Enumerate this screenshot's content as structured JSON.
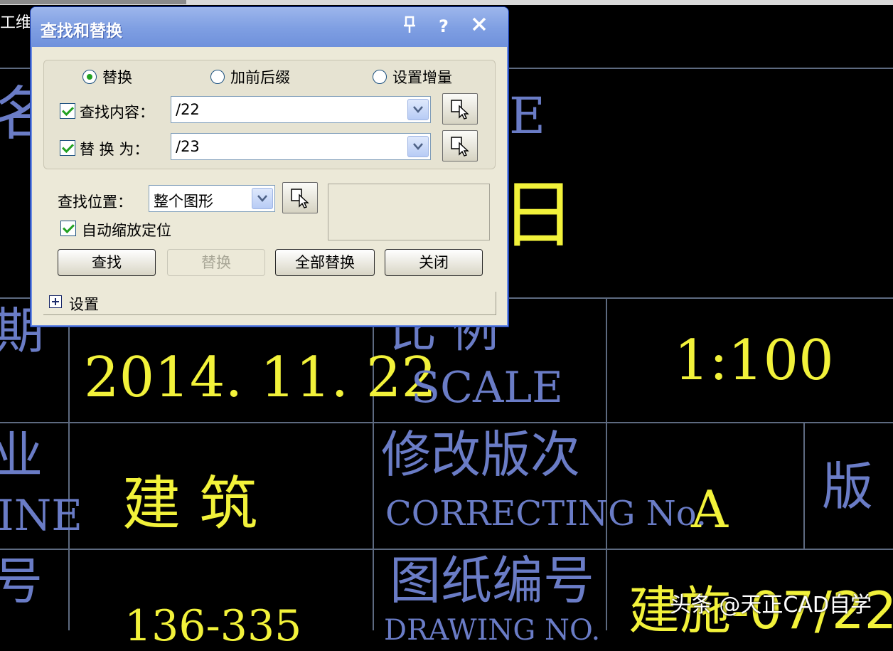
{
  "dialog": {
    "title": "查找和替换",
    "mode_options": [
      {
        "label": "替换",
        "selected": true
      },
      {
        "label": "加前后缀",
        "selected": false
      },
      {
        "label": "设置增量",
        "selected": false
      }
    ],
    "find": {
      "label": "查找内容：",
      "checked": true,
      "value": "/22"
    },
    "replace": {
      "label": "替 换 为：",
      "checked": true,
      "value": "/23"
    },
    "scope": {
      "label": "查找位置：",
      "value": "整个图形"
    },
    "auto_zoom": {
      "label": "自动缩放定位",
      "checked": true
    },
    "buttons": {
      "find": "查找",
      "replace": "替换",
      "replace_all": "全部替换",
      "close": "关闭"
    },
    "settings_toggle": "设置"
  },
  "cad": {
    "top_partial": "工维名",
    "left_chars": [
      "名",
      "期",
      "业",
      "号"
    ],
    "left_en": [
      "E",
      "INE"
    ],
    "date": "2014. 11. 22",
    "scale_cn": "比    例",
    "scale_en": "SCALE",
    "scale_value": "1:100",
    "revision_cn": "修改版次",
    "revision_en": "CORRECTING No.",
    "revision_value": "A",
    "version_char": "版",
    "discipline": "建    筑",
    "drawing_no_cn": "图纸编号",
    "drawing_no_en": "DRAWING NO.",
    "project_no": "136-335",
    "drawing_no_value": "建施-07/22",
    "right_partial": "E",
    "right_yellow": "日"
  },
  "watermark": "头条 @天正CAD自学",
  "colors": {
    "cad_blue": "#6a7cc6",
    "cad_yellow": "#f2f23a",
    "grid": "#5d6a80",
    "dialog_bg": "#ece9d8"
  }
}
